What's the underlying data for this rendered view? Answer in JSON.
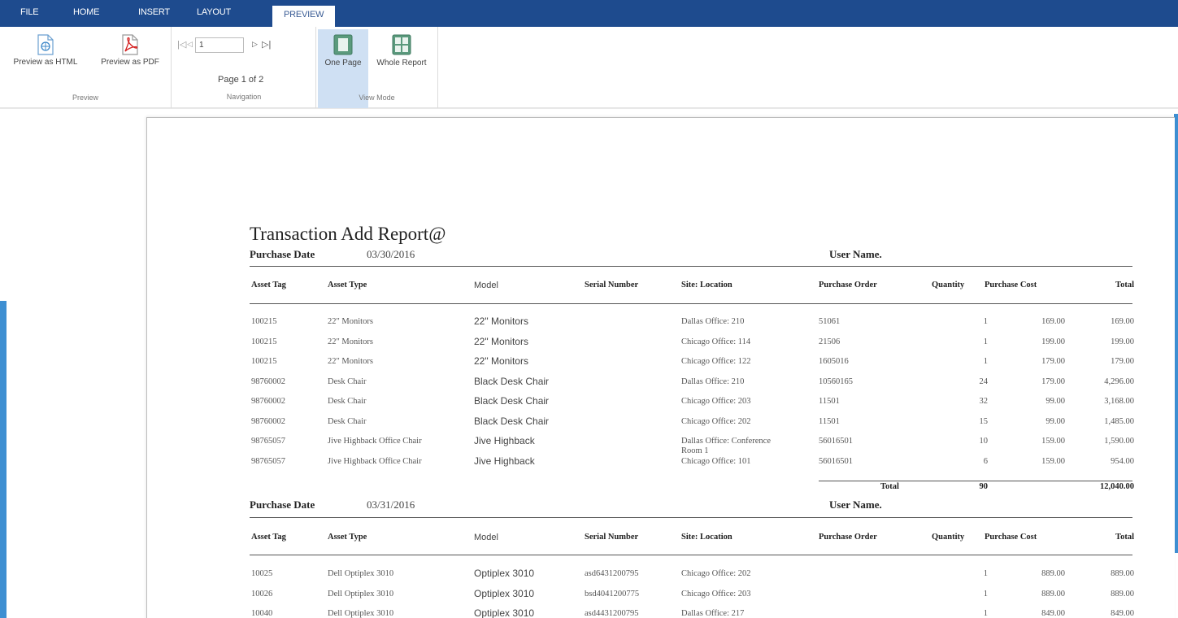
{
  "tabs": [
    {
      "label": "FILE"
    },
    {
      "label": "HOME"
    },
    {
      "label": "INSERT"
    },
    {
      "label": "LAYOUT"
    },
    {
      "label": "PREVIEW"
    }
  ],
  "active_tab": "PREVIEW",
  "ribbon": {
    "preview_group": {
      "title": "Preview",
      "html_label": "Preview as HTML",
      "pdf_label": "Preview as PDF"
    },
    "navigation_group": {
      "title": "Navigation",
      "page_value": "1",
      "page_info": "Page 1 of 2"
    },
    "view_mode_group": {
      "title": "View Mode",
      "one_page_label": "One Page",
      "whole_report_label": "Whole Report",
      "selected": "One Page"
    }
  },
  "report": {
    "title": "Transaction Add Report@",
    "columns": [
      "Asset Tag",
      "Asset Type",
      "Model",
      "Serial Number",
      "Site: Location",
      "Purchase Order",
      "Quantity",
      "Purchase Cost",
      "Total"
    ],
    "user_name_label": "User Name.",
    "purchase_date_label": "Purchase Date",
    "groups": [
      {
        "purchase_date": "03/30/2016",
        "rows": [
          [
            "100215",
            "22\" Monitors",
            "22\" Monitors",
            "",
            "Dallas Office: 210",
            "51061",
            "1",
            "169.00",
            "169.00"
          ],
          [
            "100215",
            "22\" Monitors",
            "22\" Monitors",
            "",
            "Chicago Office: 114",
            "21506",
            "1",
            "199.00",
            "199.00"
          ],
          [
            "100215",
            "22\" Monitors",
            "22\" Monitors",
            "",
            "Chicago Office: 122",
            "1605016",
            "1",
            "179.00",
            "179.00"
          ],
          [
            "98760002",
            "Desk Chair",
            "Black Desk Chair",
            "",
            "Dallas Office: 210",
            "10560165",
            "24",
            "179.00",
            "4,296.00"
          ],
          [
            "98760002",
            "Desk Chair",
            "Black Desk Chair",
            "",
            "Chicago Office: 203",
            "11501",
            "32",
            "99.00",
            "3,168.00"
          ],
          [
            "98760002",
            "Desk Chair",
            "Black Desk Chair",
            "",
            "Chicago Office: 202",
            "11501",
            "15",
            "99.00",
            "1,485.00"
          ],
          [
            "98765057",
            "Jive Highback Office Chair",
            "Jive Highback",
            "",
            "Dallas Office: Conference",
            "56016501",
            "10",
            "159.00",
            "1,590.00"
          ],
          [
            "98765057",
            "Jive Highback Office Chair",
            "Jive Highback",
            "",
            "Chicago Office: 101",
            "56016501",
            "6",
            "159.00",
            "954.00"
          ]
        ],
        "row7_location_line2": "Room 1",
        "total_label": "Total",
        "total_quantity": "90",
        "total_amount": "12,040.00"
      },
      {
        "purchase_date": "03/31/2016",
        "rows": [
          [
            "10025",
            "Dell Optiplex 3010",
            "Optiplex 3010",
            "asd6431200795",
            "Chicago Office: 202",
            "",
            "1",
            "889.00",
            "889.00"
          ],
          [
            "10026",
            "Dell Optiplex 3010",
            "Optiplex 3010",
            "bsd4041200775",
            "Chicago Office: 203",
            "",
            "1",
            "889.00",
            "889.00"
          ],
          [
            "10040",
            "Dell Optiplex 3010",
            "Optiplex 3010",
            "asd4431200795",
            "Dallas Office: 217",
            "",
            "1",
            "849.00",
            "849.00"
          ]
        ]
      }
    ]
  },
  "colors": {
    "tabbar": "#1e4b8e",
    "accent_strip": "#3e8fd2",
    "selected_mode": "#cfe0f3"
  }
}
